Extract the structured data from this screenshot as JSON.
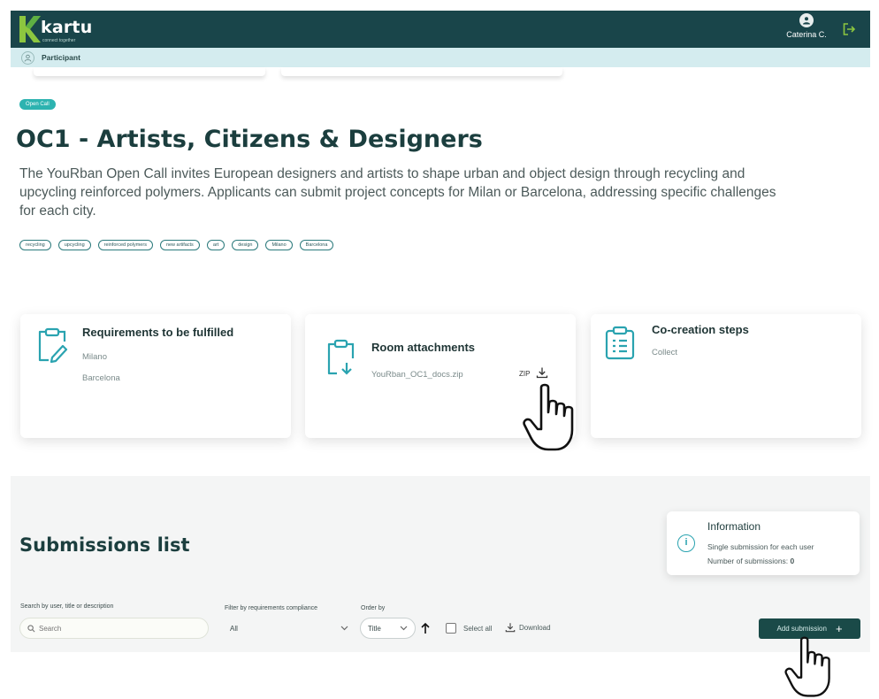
{
  "app": {
    "name": "kartu",
    "tagline": "connect together",
    "user_name": "Caterina C."
  },
  "role": {
    "label": "Participant"
  },
  "call": {
    "badge": "Open Call",
    "title": "OC1 - Artists, Citizens & Designers",
    "description": "The YouRban Open Call invites European designers and artists to shape urban and object design through recycling and upcycling reinforced polymers. Applicants can submit project concepts for Milan or Barcelona, addressing specific challenges for each city.",
    "tags": [
      "recycling",
      "upcycling",
      "reinforced polymers",
      "new artifacts",
      "art",
      "design",
      "Milano",
      "Barcelona"
    ]
  },
  "cards": {
    "requirements": {
      "title": "Requirements to be fulfilled",
      "items": [
        "Milano",
        "Barcelona"
      ]
    },
    "attachments": {
      "title": "Room attachments",
      "file_name": "YouRban_OC1_docs.zip",
      "file_type": "ZIP"
    },
    "cocreation": {
      "title": "Co-creation steps",
      "items": [
        "Collect"
      ]
    }
  },
  "submissions": {
    "title": "Submissions list",
    "info": {
      "title": "Information",
      "line1": "Single submission for each user",
      "count_label": "Number of submissions:",
      "count": "0"
    },
    "filters": {
      "search_label": "Search by user, title or description",
      "search_placeholder": "Search",
      "compliance_label": "Filter by requirements compliance",
      "compliance_value": "All",
      "order_label": "Order by",
      "order_value": "Title",
      "select_all": "Select all",
      "download": "Download"
    },
    "add_button": "Add submission"
  },
  "colors": {
    "topbar": "#19454a",
    "rolebar": "#d4ecef",
    "accent": "#2db3b0",
    "button": "#1a4a48"
  },
  "icons": [
    "kartu-logo-icon",
    "user-avatar-icon",
    "logout-icon",
    "participant-icon",
    "clipboard-edit-icon",
    "clipboard-download-icon",
    "checklist-icon",
    "download-icon",
    "info-icon",
    "search-icon",
    "chevron-down-icon",
    "arrow-up-icon",
    "plus-icon",
    "hand-pointer-icon"
  ]
}
